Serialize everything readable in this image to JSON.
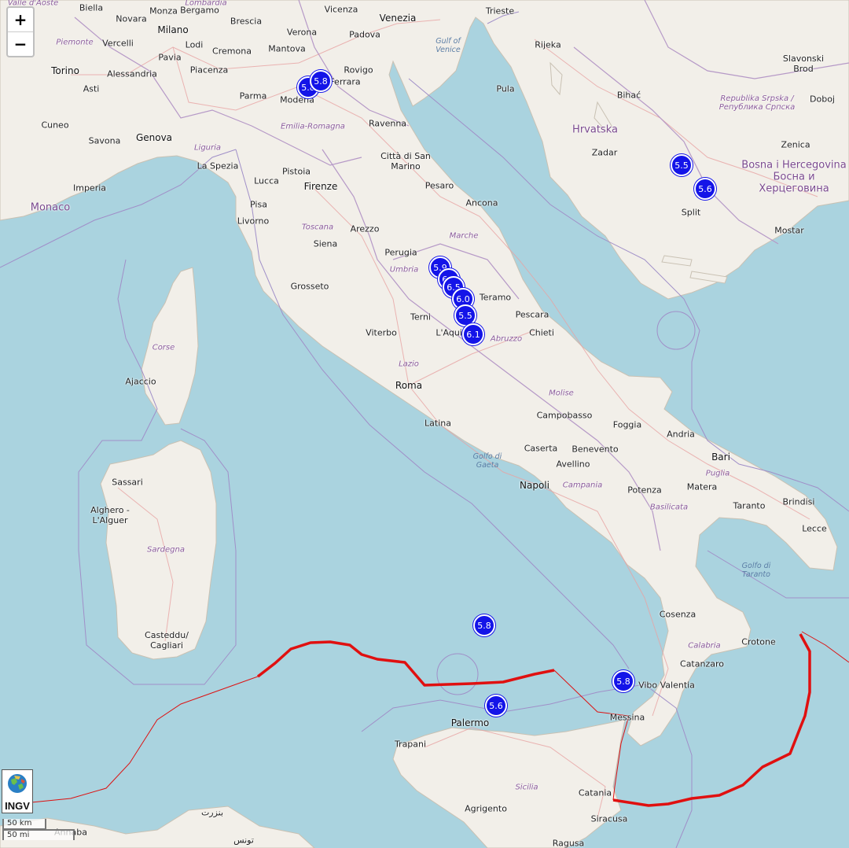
{
  "controls": {
    "zoom_in": "+",
    "zoom_out": "−"
  },
  "logo": {
    "text": "INGV"
  },
  "scale": {
    "km": "50 km",
    "mi": "50 mi"
  },
  "labels": [
    {
      "text": "Valle d'Aoste",
      "kind": "region"
    },
    {
      "text": "Biella",
      "kind": "city"
    },
    {
      "text": "Monza",
      "kind": "city"
    },
    {
      "text": "Lombardia",
      "kind": "region"
    },
    {
      "text": "Bergamo",
      "kind": "city"
    },
    {
      "text": "Vicenza",
      "kind": "city"
    },
    {
      "text": "Venezia",
      "kind": "city"
    },
    {
      "text": "Trieste",
      "kind": "city"
    },
    {
      "text": "Novara",
      "kind": "city"
    },
    {
      "text": "Milano",
      "kind": "big"
    },
    {
      "text": "Brescia",
      "kind": "city"
    },
    {
      "text": "Verona",
      "kind": "city"
    },
    {
      "text": "Padova",
      "kind": "city"
    },
    {
      "text": "Piemonte",
      "kind": "region"
    },
    {
      "text": "Vercelli",
      "kind": "city"
    },
    {
      "text": "Lodi",
      "kind": "city"
    },
    {
      "text": "Gulf of Venice",
      "kind": "sea"
    },
    {
      "text": "Rijeka",
      "kind": "city"
    },
    {
      "text": "Pavia",
      "kind": "city"
    },
    {
      "text": "Cremona",
      "kind": "city"
    },
    {
      "text": "Mantova",
      "kind": "city"
    },
    {
      "text": "Torino",
      "kind": "big"
    },
    {
      "text": "Alessandria",
      "kind": "city"
    },
    {
      "text": "Asti",
      "kind": "city"
    },
    {
      "text": "Piacenza",
      "kind": "city"
    },
    {
      "text": "Ferrara",
      "kind": "city"
    },
    {
      "text": "Rovigo",
      "kind": "city"
    },
    {
      "text": "Parma",
      "kind": "city"
    },
    {
      "text": "Modena",
      "kind": "city"
    },
    {
      "text": "Pula",
      "kind": "city"
    },
    {
      "text": "Bihać",
      "kind": "city"
    },
    {
      "text": "Republika Srpska / Република Српска",
      "kind": "region"
    },
    {
      "text": "Slavonski Brod",
      "kind": "city"
    },
    {
      "text": "Doboj",
      "kind": "city"
    },
    {
      "text": "Cuneo",
      "kind": "city"
    },
    {
      "text": "Emilia-Romagna",
      "kind": "region"
    },
    {
      "text": "Ravenna",
      "kind": "city"
    },
    {
      "text": "Hrvatska",
      "kind": "country"
    },
    {
      "text": "Savona",
      "kind": "city"
    },
    {
      "text": "Genova",
      "kind": "big"
    },
    {
      "text": "Zenica",
      "kind": "city"
    },
    {
      "text": "Liguria",
      "kind": "region"
    },
    {
      "text": "Città di San Marino",
      "kind": "city"
    },
    {
      "text": "Zadar",
      "kind": "city"
    },
    {
      "text": "Bosna i Hercegovina Босна и Херцеговина",
      "kind": "country"
    },
    {
      "text": "La Spezia",
      "kind": "city"
    },
    {
      "text": "Pistoia",
      "kind": "city"
    },
    {
      "text": "Imperia",
      "kind": "city"
    },
    {
      "text": "Lucca",
      "kind": "city"
    },
    {
      "text": "Firenze",
      "kind": "big"
    },
    {
      "text": "Pesaro",
      "kind": "city"
    },
    {
      "text": "Monaco",
      "kind": "country"
    },
    {
      "text": "Pisa",
      "kind": "city"
    },
    {
      "text": "Ancona",
      "kind": "city"
    },
    {
      "text": "Split",
      "kind": "city"
    },
    {
      "text": "Livorno",
      "kind": "city"
    },
    {
      "text": "Toscana",
      "kind": "region"
    },
    {
      "text": "Arezzo",
      "kind": "city"
    },
    {
      "text": "Mostar",
      "kind": "city"
    },
    {
      "text": "Marche",
      "kind": "region"
    },
    {
      "text": "Siena",
      "kind": "city"
    },
    {
      "text": "Perugia",
      "kind": "city"
    },
    {
      "text": "Umbria",
      "kind": "region"
    },
    {
      "text": "Grosseto",
      "kind": "city"
    },
    {
      "text": "Teramo",
      "kind": "city"
    },
    {
      "text": "Terni",
      "kind": "city"
    },
    {
      "text": "Pescara",
      "kind": "city"
    },
    {
      "text": "Corse",
      "kind": "region"
    },
    {
      "text": "Viterbo",
      "kind": "city"
    },
    {
      "text": "L'Aquila",
      "kind": "city"
    },
    {
      "text": "Chieti",
      "kind": "city"
    },
    {
      "text": "Abruzzo",
      "kind": "region"
    },
    {
      "text": "Lazio",
      "kind": "region"
    },
    {
      "text": "Ajaccio",
      "kind": "city"
    },
    {
      "text": "Roma",
      "kind": "big"
    },
    {
      "text": "Molise",
      "kind": "region"
    },
    {
      "text": "Campobasso",
      "kind": "city"
    },
    {
      "text": "Latina",
      "kind": "city"
    },
    {
      "text": "Foggia",
      "kind": "city"
    },
    {
      "text": "Andria",
      "kind": "city"
    },
    {
      "text": "Golfo di Gaeta",
      "kind": "sea"
    },
    {
      "text": "Caserta",
      "kind": "city"
    },
    {
      "text": "Benevento",
      "kind": "city"
    },
    {
      "text": "Bari",
      "kind": "big"
    },
    {
      "text": "Avellino",
      "kind": "city"
    },
    {
      "text": "Puglia",
      "kind": "region"
    },
    {
      "text": "Sassari",
      "kind": "city"
    },
    {
      "text": "Napoli",
      "kind": "big"
    },
    {
      "text": "Campania",
      "kind": "region"
    },
    {
      "text": "Matera",
      "kind": "city"
    },
    {
      "text": "Potenza",
      "kind": "city"
    },
    {
      "text": "Taranto",
      "kind": "city"
    },
    {
      "text": "Brindisi",
      "kind": "city"
    },
    {
      "text": "Alghero - L'Alguer",
      "kind": "city"
    },
    {
      "text": "Basilicata",
      "kind": "region"
    },
    {
      "text": "Lecce",
      "kind": "city"
    },
    {
      "text": "Sardegna",
      "kind": "region"
    },
    {
      "text": "Golfo di Taranto",
      "kind": "sea"
    },
    {
      "text": "Cosenza",
      "kind": "city"
    },
    {
      "text": "Casteddu/ Cagliari",
      "kind": "city"
    },
    {
      "text": "Crotone",
      "kind": "city"
    },
    {
      "text": "Calabria",
      "kind": "region"
    },
    {
      "text": "Catanzaro",
      "kind": "city"
    },
    {
      "text": "Vibo Valentia",
      "kind": "city"
    },
    {
      "text": "Palermo",
      "kind": "big"
    },
    {
      "text": "Messina",
      "kind": "city"
    },
    {
      "text": "Trapani",
      "kind": "city"
    },
    {
      "text": "Sicilia",
      "kind": "region"
    },
    {
      "text": "Catania",
      "kind": "city"
    },
    {
      "text": "Agrigento",
      "kind": "city"
    },
    {
      "text": "Siracusa",
      "kind": "city"
    },
    {
      "text": "Ragusa",
      "kind": "city"
    },
    {
      "text": "Annaba",
      "kind": "city"
    },
    {
      "text": "بنزرت",
      "kind": "city"
    },
    {
      "text": "تونس",
      "kind": "city"
    }
  ],
  "earthquakes": [
    {
      "magnitude": "5.8"
    },
    {
      "magnitude": "5.8"
    },
    {
      "magnitude": "5.5"
    },
    {
      "magnitude": "5.6"
    },
    {
      "magnitude": "5.9"
    },
    {
      "magnitude": "6.5"
    },
    {
      "magnitude": "6.5"
    },
    {
      "magnitude": "6.0"
    },
    {
      "magnitude": "5.5"
    },
    {
      "magnitude": "6.1"
    },
    {
      "magnitude": "5.8"
    },
    {
      "magnitude": "5.8"
    },
    {
      "magnitude": "5.6"
    }
  ]
}
